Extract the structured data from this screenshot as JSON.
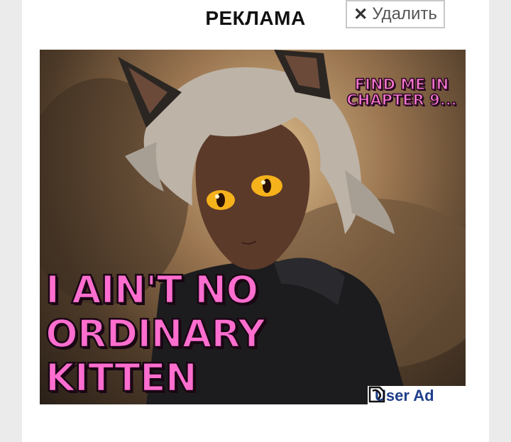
{
  "ad_block": {
    "heading": "РЕКЛАМА",
    "remove_button": {
      "label": "Удалить",
      "icon": "close-icon"
    }
  },
  "banner": {
    "find_me_text": "FIND ME IN CHAPTER 9...",
    "title_lines": [
      "I AIN'T NO",
      "ORDINARY",
      "KITTEN"
    ],
    "user_ad_label": "User Ad",
    "user_ad_icon": "logo-icon",
    "colors": {
      "title_pink": "#ff6ecf",
      "badge_blue": "#1f3f8a"
    }
  }
}
